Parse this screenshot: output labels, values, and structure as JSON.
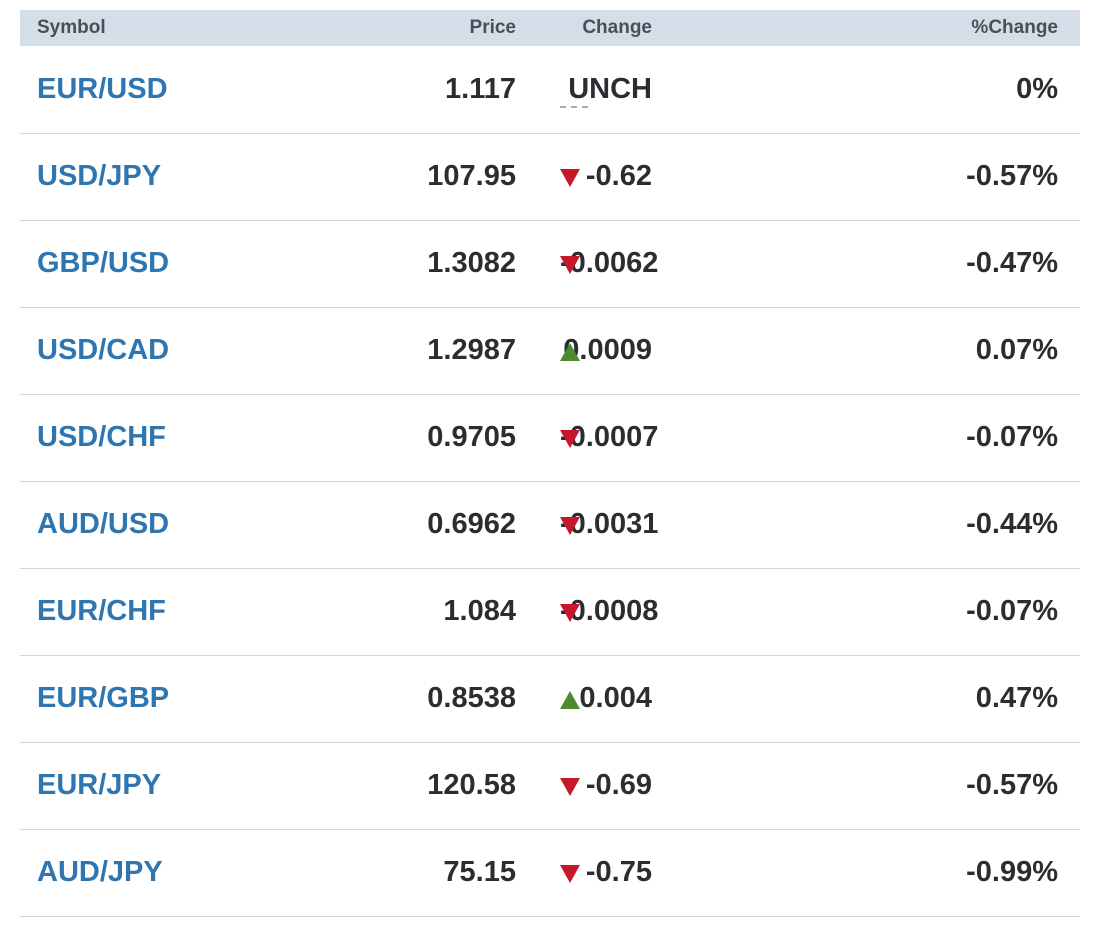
{
  "colors": {
    "header_bg": "#d4dee8",
    "link": "#2f76b0",
    "down": "#c6182a",
    "up": "#4f8a33",
    "unchanged": "#a8adb2"
  },
  "table": {
    "headers": {
      "symbol": "Symbol",
      "price": "Price",
      "change": "Change",
      "pct_change": "%Change"
    },
    "rows": [
      {
        "symbol": "EUR/USD",
        "price": "1.117",
        "direction": "unch",
        "change": "UNCH",
        "pct": "0%"
      },
      {
        "symbol": "USD/JPY",
        "price": "107.95",
        "direction": "down",
        "change": "-0.62",
        "pct": "-0.57%"
      },
      {
        "symbol": "GBP/USD",
        "price": "1.3082",
        "direction": "down",
        "change": "-0.0062",
        "pct": "-0.47%"
      },
      {
        "symbol": "USD/CAD",
        "price": "1.2987",
        "direction": "up",
        "change": "0.0009",
        "pct": "0.07%"
      },
      {
        "symbol": "USD/CHF",
        "price": "0.9705",
        "direction": "down",
        "change": "-0.0007",
        "pct": "-0.07%"
      },
      {
        "symbol": "AUD/USD",
        "price": "0.6962",
        "direction": "down",
        "change": "-0.0031",
        "pct": "-0.44%"
      },
      {
        "symbol": "EUR/CHF",
        "price": "1.084",
        "direction": "down",
        "change": "-0.0008",
        "pct": "-0.07%"
      },
      {
        "symbol": "EUR/GBP",
        "price": "0.8538",
        "direction": "up",
        "change": "0.004",
        "pct": "0.47%"
      },
      {
        "symbol": "EUR/JPY",
        "price": "120.58",
        "direction": "down",
        "change": "-0.69",
        "pct": "-0.57%"
      },
      {
        "symbol": "AUD/JPY",
        "price": "75.15",
        "direction": "down",
        "change": "-0.75",
        "pct": "-0.99%"
      }
    ]
  }
}
